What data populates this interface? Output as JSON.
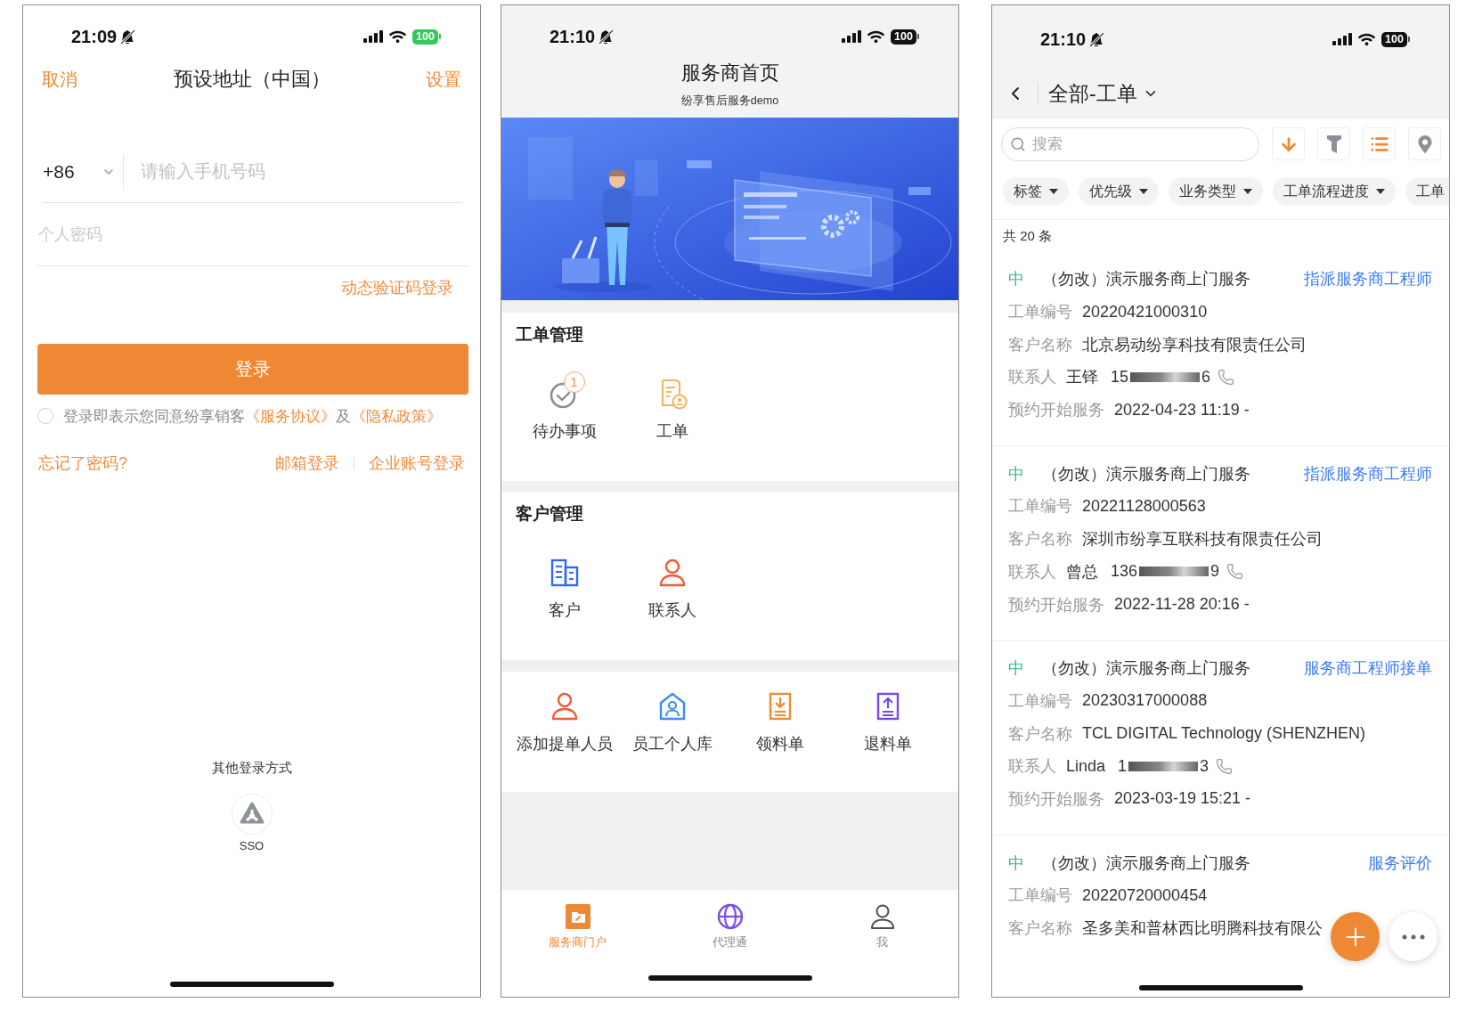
{
  "login_screen": {
    "status_bar": {
      "time": "21:09",
      "silent": true,
      "battery": "100",
      "charging": true
    },
    "nav": {
      "cancel": "取消",
      "title": "预设地址（中国）",
      "settings": "设置"
    },
    "phone_field": {
      "country_code": "+86",
      "placeholder": "请输入手机号码"
    },
    "password_field": {
      "placeholder": "个人密码"
    },
    "sms_login": "动态验证码登录",
    "login_button": "登录",
    "agreement": {
      "checked": false,
      "parts": [
        {
          "text": "登录即表示您同意纷享销客",
          "link": false
        },
        {
          "text": "《服务协议》",
          "link": true
        },
        {
          "text": "及",
          "link": false
        },
        {
          "text": "《隐私政策》",
          "link": true
        }
      ]
    },
    "forgot_password": "忘记了密码?",
    "alt_logins": [
      "邮箱登录",
      "企业账号登录"
    ],
    "other_login": {
      "title": "其他登录方式",
      "methods": [
        {
          "label": "SSO"
        }
      ]
    }
  },
  "home_screen": {
    "status_bar": {
      "time": "21:10",
      "silent": true,
      "battery": "100",
      "charging": false
    },
    "title": "服务商首页",
    "subtitle": "纷享售后服务demo",
    "sections": [
      {
        "title": "工单管理",
        "items": [
          {
            "kind": "todo",
            "label": "待办事项",
            "badge": "1"
          },
          {
            "kind": "work-order",
            "label": "工单"
          }
        ]
      },
      {
        "title": "客户管理",
        "items": [
          {
            "kind": "customer",
            "label": "客户"
          },
          {
            "kind": "contact",
            "label": "联系人"
          }
        ]
      },
      {
        "items": [
          {
            "kind": "contact",
            "label": "添加提单人员"
          },
          {
            "kind": "staff",
            "label": "员工个人库"
          },
          {
            "kind": "receive",
            "label": "领料单"
          },
          {
            "kind": "return",
            "label": "退料单"
          }
        ]
      }
    ],
    "tab_bar": [
      {
        "kind": "portal",
        "label": "服务商门户",
        "selected": true
      },
      {
        "kind": "globe",
        "label": "代理通",
        "selected": false
      },
      {
        "kind": "person",
        "label": "我",
        "selected": false
      }
    ]
  },
  "work_order_screen": {
    "status_bar": {
      "time": "21:10",
      "silent": true,
      "battery": "100",
      "charging": false
    },
    "title": "全部-工单",
    "search": {
      "placeholder": "搜索"
    },
    "tools": [
      {
        "kind": "sort",
        "active": true
      },
      {
        "kind": "filter",
        "active": false
      },
      {
        "kind": "list",
        "active": true
      },
      {
        "kind": "map",
        "active": false
      }
    ],
    "filters": [
      {
        "label": "标签",
        "caret": true
      },
      {
        "label": "优先级",
        "caret": true
      },
      {
        "label": "业务类型",
        "caret": true
      },
      {
        "label": "工单流程进度",
        "caret": true
      },
      {
        "label": "工单",
        "caret": false
      }
    ],
    "count": "共 20 条",
    "orders": [
      {
        "priority": "中",
        "title": "（勿改）演示服务商上门服务",
        "action": "指派服务商工程师",
        "rows": [
          {
            "kind": "text",
            "label": "工单编号",
            "value": "20220421000310"
          },
          {
            "kind": "text",
            "label": "客户名称",
            "value": "北京易动纷享科技有限责任公司"
          },
          {
            "kind": "contact",
            "label": "联系人",
            "name": "王铎",
            "phone_start": "15",
            "phone_end": "6"
          },
          {
            "kind": "text",
            "label": "预约开始服务",
            "value": "2022-04-23 11:19 -"
          }
        ]
      },
      {
        "priority": "中",
        "title": "（勿改）演示服务商上门服务",
        "action": "指派服务商工程师",
        "rows": [
          {
            "kind": "text",
            "label": "工单编号",
            "value": "20221128000563"
          },
          {
            "kind": "text",
            "label": "客户名称",
            "value": "深圳市纷享互联科技有限责任公司"
          },
          {
            "kind": "contact",
            "label": "联系人",
            "name": "曾总",
            "phone_start": "136",
            "phone_end": "9"
          },
          {
            "kind": "text",
            "label": "预约开始服务",
            "value": "2022-11-28 20:16 -"
          }
        ]
      },
      {
        "priority": "中",
        "title": "（勿改）演示服务商上门服务",
        "action": "服务商工程师接单",
        "rows": [
          {
            "kind": "text",
            "label": "工单编号",
            "value": "20230317000088"
          },
          {
            "kind": "text",
            "label": "客户名称",
            "value": "TCL DIGITAL Technology (SHENZHEN)"
          },
          {
            "kind": "contact",
            "label": "联系人",
            "name": "Linda",
            "phone_start": "1",
            "phone_end": "3"
          },
          {
            "kind": "text",
            "label": "预约开始服务",
            "value": "2023-03-19 15:21 -"
          }
        ]
      },
      {
        "priority": "中",
        "title": "（勿改）演示服务商上门服务",
        "action": "服务评价",
        "rows": [
          {
            "kind": "text",
            "label": "工单编号",
            "value": "20220720000454"
          },
          {
            "kind": "text",
            "label": "客户名称",
            "value": "圣多美和普林西比明腾科技有限公"
          }
        ]
      }
    ]
  }
}
